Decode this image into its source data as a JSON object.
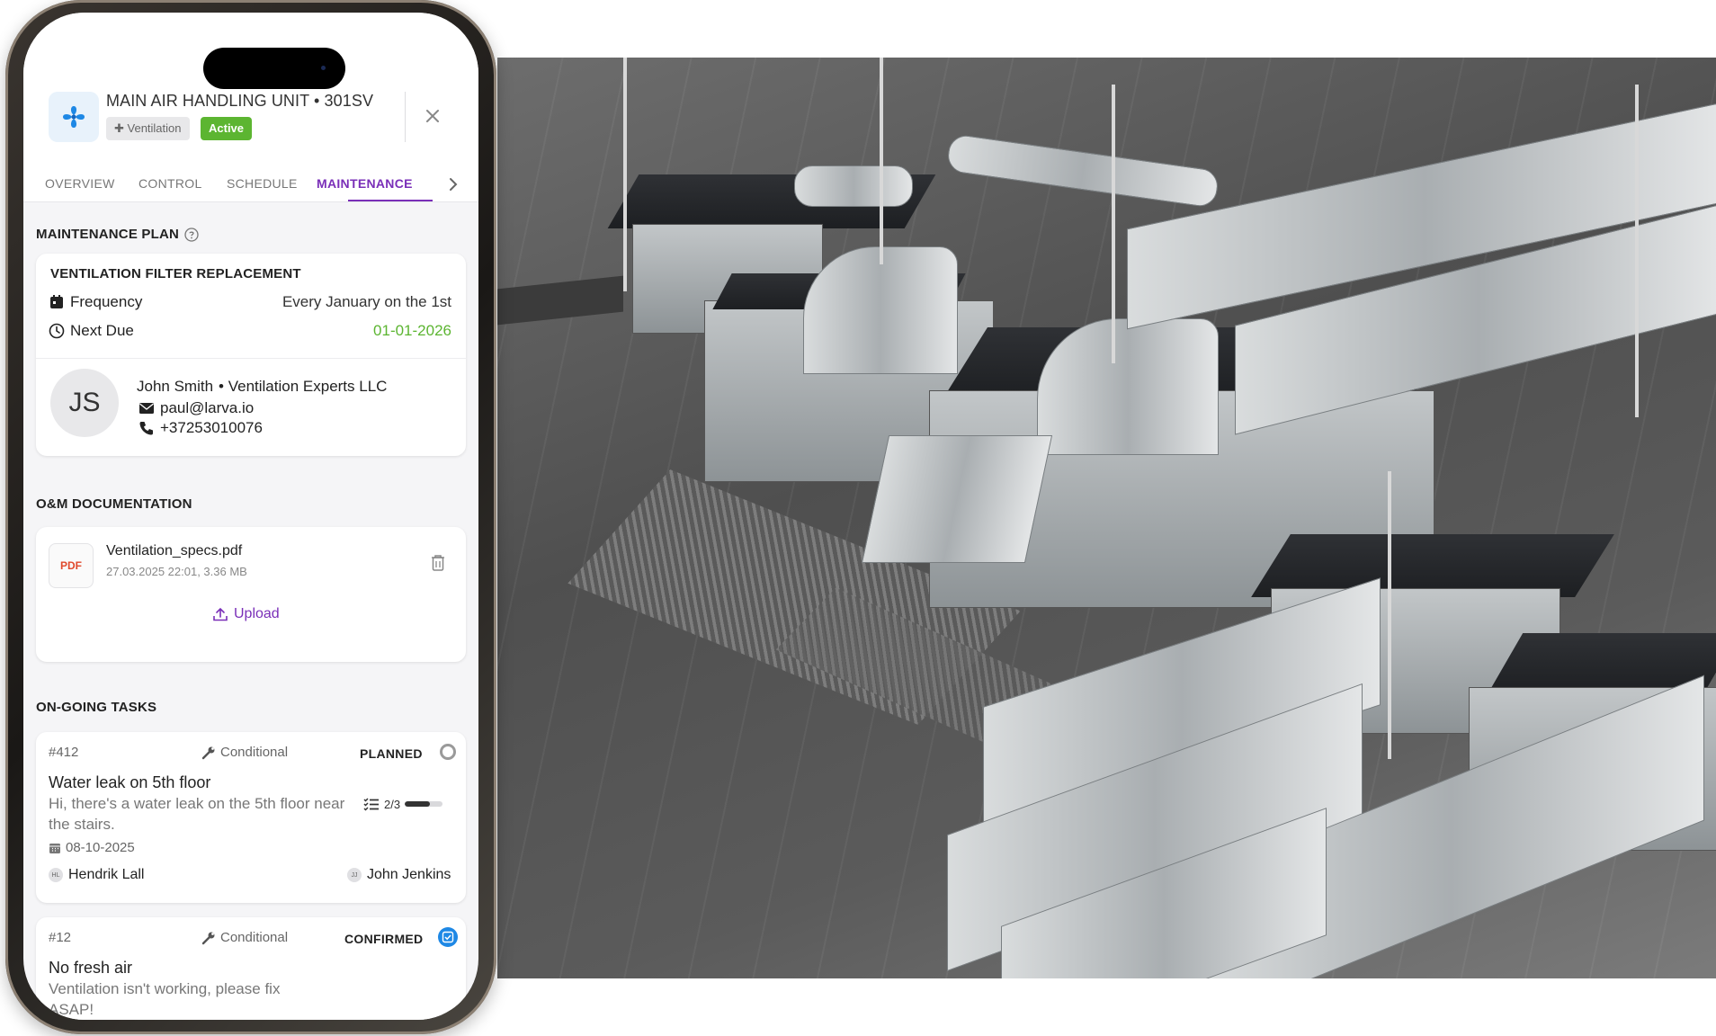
{
  "header": {
    "title": "MAIN AIR HANDLING UNIT • 301SV",
    "category_chip": "✚ Ventilation",
    "status_chip": "Active",
    "app_icon": "fan-icon",
    "close_icon": "close-icon"
  },
  "tabs": [
    {
      "label": "OVERVIEW"
    },
    {
      "label": "CONTROL"
    },
    {
      "label": "SCHEDULE"
    },
    {
      "label": "MAINTENANCE",
      "active": true
    }
  ],
  "maintenance_plan": {
    "section_title": "MAINTENANCE PLAN",
    "help_icon": "help-circle-icon",
    "plan_name": "VENTILATION FILTER REPLACEMENT",
    "frequency_label": "Frequency",
    "frequency_value": "Every January on the 1st",
    "next_due_label": "Next Due",
    "next_due_value": "01-01-2026",
    "next_due_color": "#5cb531",
    "contact": {
      "initials": "JS",
      "name": "John Smith",
      "company": "• Ventilation Experts LLC",
      "email": "paul@larva.io",
      "phone": "+37253010076"
    }
  },
  "documentation": {
    "section_title": "O&M DOCUMENTATION",
    "file_type": "PDF",
    "file_name": "Ventilation_specs.pdf",
    "file_meta": "27.03.2025 22:01, 3.36 MB",
    "upload_label": "Upload"
  },
  "tasks": {
    "section_title": "ON-GOING TASKS",
    "items": [
      {
        "id": "#412",
        "type": "Conditional",
        "status": "PLANNED",
        "title": "Water leak on 5th floor",
        "description": "Hi, there's a water leak on the 5th floor near the stairs.",
        "checklist": "2/3",
        "checklist_progress": 0.66,
        "date": "08-10-2025",
        "reporter_initials": "HL",
        "reporter": "Hendrik Lall",
        "assignee_initials": "JJ",
        "assignee": "John Jenkins"
      },
      {
        "id": "#12",
        "type": "Conditional",
        "status": "CONFIRMED",
        "title": "No fresh air",
        "description": "Ventilation isn't working, please fix ASAP!"
      }
    ]
  },
  "colors": {
    "accent": "#7a2fb8",
    "active_green": "#5cb531",
    "confirmed_blue": "#1e88e5",
    "pdf_red": "#e0492c"
  }
}
